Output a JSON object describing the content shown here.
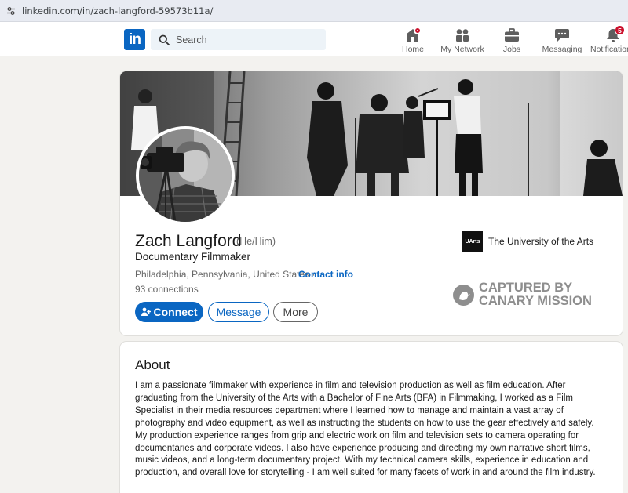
{
  "browser": {
    "url": "linkedin.com/in/zach-langford-59573b11a/"
  },
  "nav": {
    "logo": "in",
    "search_placeholder": "Search",
    "items": [
      {
        "label": "Home",
        "icon": "home-icon"
      },
      {
        "label": "My Network",
        "icon": "network-icon"
      },
      {
        "label": "Jobs",
        "icon": "briefcase-icon"
      },
      {
        "label": "Messaging",
        "icon": "messaging-icon"
      },
      {
        "label": "Notifications",
        "icon": "bell-icon",
        "badge": "5"
      }
    ],
    "brand_color": "#0a66c2",
    "badge_color": "#cb112d"
  },
  "profile": {
    "name": "Zach Langford",
    "pronouns": "(He/Him)",
    "headline": "Documentary Filmmaker",
    "location": "Philadelphia, Pennsylvania, United States",
    "separator": " · ",
    "contact_info": "Contact info",
    "connections": "93 connections",
    "actions": {
      "connect": "Connect",
      "message": "Message",
      "more": "More"
    },
    "education": {
      "logo_text": "UArts",
      "name": "The University of the Arts"
    }
  },
  "watermark": {
    "line1": "CAPTURED BY",
    "line2": "CANARY MISSION"
  },
  "about": {
    "title": "About",
    "text": "I am a passionate filmmaker with experience in film and television production as well as film education. After graduating from the University of the Arts with a Bachelor of Fine Arts (BFA) in Filmmaking, I worked as a Film Specialist in their media resources department where I learned how to manage and maintain a vast array of photography and video equipment, as well as instructing the students on how to use the gear effectively and safely. My production experience ranges from grip and electric work on film and television sets to camera operating for documentaries and corporate videos. I also have experience producing and directing my own narrative short films, music videos, and a long-term documentary project. With my technical camera skills, experience in education and production, and overall love for storytelling - I am well suited for many facets of work in and around the film industry."
  }
}
